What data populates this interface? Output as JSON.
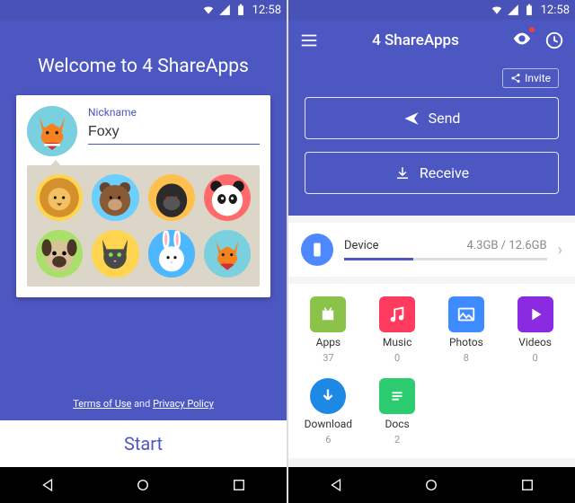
{
  "status": {
    "time": "12:58"
  },
  "left": {
    "welcome": "Welcome to 4 ShareApps",
    "nickname_label": "Nickname",
    "nickname_value": "Foxy",
    "avatars": [
      "fox",
      "lion",
      "bear",
      "gorilla",
      "panda",
      "pug",
      "cat",
      "rabbit",
      "fox2"
    ],
    "terms_text": "Terms of Use",
    "and_text": " and ",
    "privacy_text": "Privacy Policy",
    "start_label": "Start"
  },
  "right": {
    "app_title": "4 ShareApps",
    "invite_label": "Invite",
    "send_label": "Send",
    "receive_label": "Receive",
    "device": {
      "label": "Device",
      "used": "4.3GB",
      "total": "12.6GB",
      "sep": " / ",
      "fill_pct": 34
    },
    "categories": [
      {
        "name": "Apps",
        "count": 37,
        "color": "#8bc34a",
        "icon": "android"
      },
      {
        "name": "Music",
        "count": 0,
        "color": "#ff3b60",
        "icon": "music"
      },
      {
        "name": "Photos",
        "count": 8,
        "color": "#3d8bff",
        "icon": "photo"
      },
      {
        "name": "Videos",
        "count": 0,
        "color": "#8a2be2",
        "icon": "play"
      },
      {
        "name": "Download",
        "count": 6,
        "color": "#1e88e5",
        "icon": "download"
      },
      {
        "name": "Docs",
        "count": 2,
        "color": "#2e7d5f",
        "icon": "doc"
      }
    ]
  }
}
